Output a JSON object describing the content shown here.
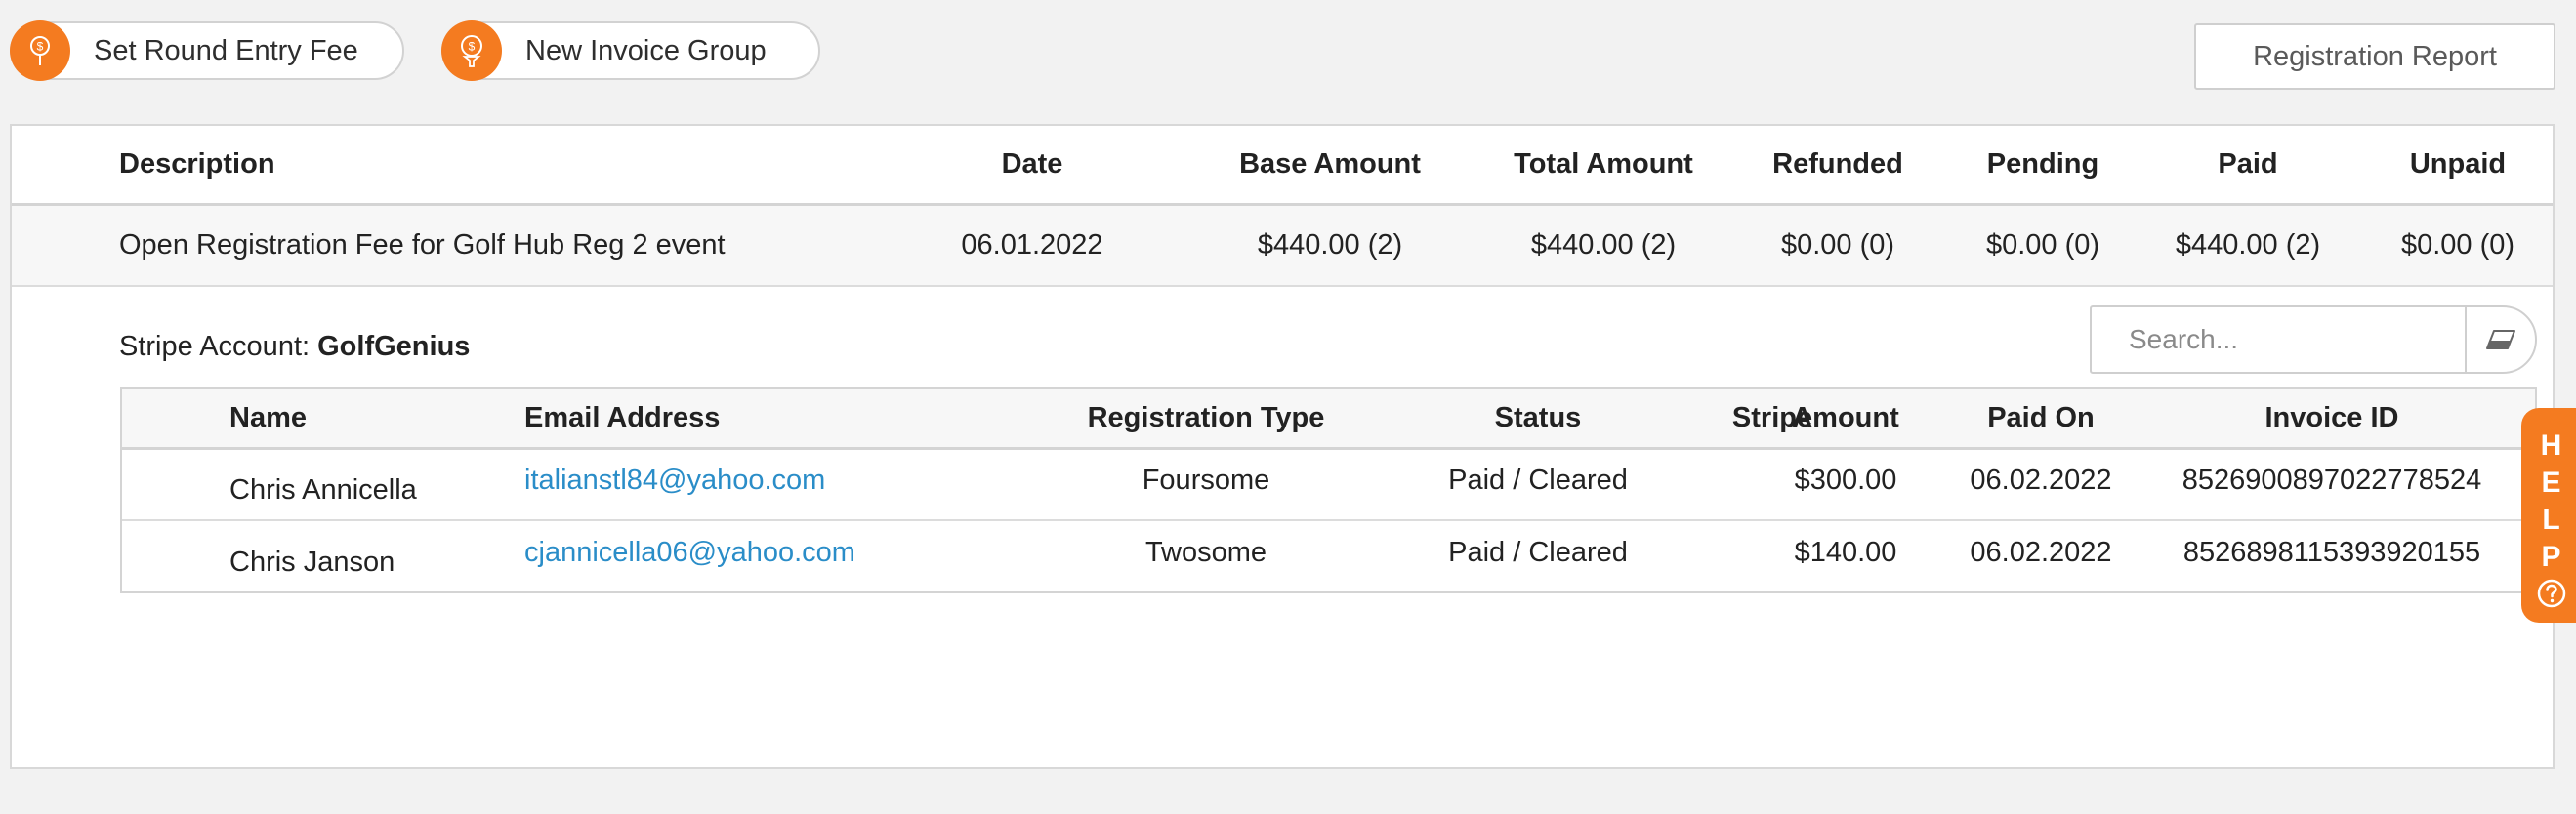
{
  "toolbar": {
    "round_fee_label": "Set Round Entry Fee",
    "invoice_group_label": "New Invoice Group",
    "report_label": "Registration Report"
  },
  "main_table": {
    "headers": {
      "description": "Description",
      "date": "Date",
      "base_amount": "Base Amount",
      "total_amount": "Total Amount",
      "refunded": "Refunded",
      "pending": "Pending",
      "paid": "Paid",
      "unpaid": "Unpaid"
    },
    "row": {
      "description": "Open Registration Fee for Golf Hub Reg 2 event",
      "date": "06.01.2022",
      "base_amount": "$440.00 (2)",
      "total_amount": "$440.00 (2)",
      "refunded": "$0.00 (0)",
      "pending": "$0.00 (0)",
      "paid": "$440.00 (2)",
      "unpaid": "$0.00 (0)"
    }
  },
  "stripe": {
    "label": "Stripe Account: ",
    "account": "GolfGenius"
  },
  "search": {
    "placeholder": "Search..."
  },
  "sub_table": {
    "headers": {
      "name": "Name",
      "email": "Email Address",
      "reg_type": "Registration Type",
      "status": "Status",
      "stripe": "Stripe",
      "amount": "Amount",
      "paid_on": "Paid On",
      "invoice_id": "Invoice ID"
    },
    "rows": [
      {
        "name": "Chris Annicella",
        "email": "italianstl84@yahoo.com",
        "reg_type": "Foursome",
        "status": "Paid / Cleared",
        "stripe": "",
        "amount": "$300.00",
        "paid_on": "06.02.2022",
        "invoice_id": "852690089702277852​4"
      },
      {
        "name": "Chris Janson",
        "email": "cjannicella06@yahoo.com",
        "reg_type": "Twosome",
        "status": "Paid / Cleared",
        "stripe": "",
        "amount": "$140.00",
        "paid_on": "06.02.2022",
        "invoice_id": "852689811539392015​5"
      }
    ]
  },
  "help": {
    "letters": [
      "H",
      "E",
      "L",
      "P"
    ]
  },
  "colors": {
    "accent": "#f47b20",
    "link": "#2a8dc8"
  }
}
